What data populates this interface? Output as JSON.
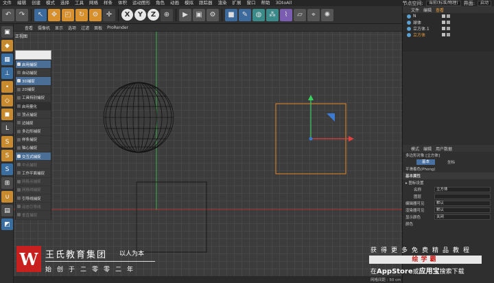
{
  "menu": {
    "items": [
      "文件",
      "编辑",
      "创建",
      "模式",
      "选择",
      "工具",
      "网格",
      "样条",
      "体积",
      "运动图形",
      "角色",
      "动画",
      "模拟",
      "跟踪器",
      "渲染",
      "扩展",
      "窗口",
      "帮助",
      "3DtoAll"
    ],
    "node_space_label": "节点空间:",
    "node_space_value": "当前(标准/物理)",
    "layout_label": "界面:",
    "layout_value": "启动"
  },
  "toolbar": {
    "axis_x": "X",
    "axis_y": "Y",
    "axis_z": "Z"
  },
  "viewport": {
    "menu": [
      "查看",
      "摄像机",
      "显示",
      "选项",
      "过滤",
      "面板",
      "ProRender"
    ],
    "title": "正视图",
    "status": "网格间距 : 50 cm"
  },
  "snap_menu": {
    "items": [
      {
        "label": "启用捕捉",
        "state": "hl"
      },
      {
        "label": "自动捕捉",
        "state": ""
      },
      {
        "label": "3D捕捉",
        "state": "hl"
      },
      {
        "label": "2D捕捉",
        "state": ""
      },
      {
        "label": "工具特别捕捉",
        "state": ""
      },
      {
        "label": "启用量化",
        "state": "head"
      },
      {
        "label": "顶点捕捉",
        "state": ""
      },
      {
        "label": "边捕捉",
        "state": ""
      },
      {
        "label": "多边形捕捉",
        "state": ""
      },
      {
        "label": "样条捕捉",
        "state": ""
      },
      {
        "label": "轴心捕捉",
        "state": ""
      },
      {
        "label": "交互式捕捉",
        "state": "hl"
      },
      {
        "label": "中点捕捉",
        "state": "dim"
      },
      {
        "label": "工作平面捕捉",
        "state": ""
      },
      {
        "label": "网格点捕捉",
        "state": "dim"
      },
      {
        "label": "网格线捕捉",
        "state": "dim"
      },
      {
        "label": "引导线捕捉",
        "state": ""
      },
      {
        "label": "动态引导线",
        "state": "dim"
      },
      {
        "label": "垂直捕捉",
        "state": "dim"
      }
    ]
  },
  "objects": {
    "tabs": [
      "文件",
      "编辑",
      "查看"
    ],
    "items": [
      {
        "name": "N",
        "selected": false
      },
      {
        "name": "球体",
        "selected": false
      },
      {
        "name": "立方体.1",
        "selected": false
      },
      {
        "name": "立方体",
        "selected": true
      }
    ]
  },
  "attributes": {
    "tabs": [
      "模式",
      "编辑",
      "用户数据"
    ],
    "object_label": "多边形对象 [立方体]",
    "tab_basic": "基本",
    "tab_coord": "坐标",
    "phong": "平滑着色(Phong)",
    "section": "基本属性",
    "icon_settings": "▸ 图标设置",
    "name_label": "名称",
    "name_value": "立方体",
    "layer_label": "图层",
    "editor_vis_label": "编辑器可见",
    "editor_vis_value": "默认",
    "render_vis_label": "渲染器可见",
    "render_vis_value": "默认",
    "color_label": "显示颜色",
    "color_value": "关闭",
    "color2_label": "颜色",
    "colors": {
      "accent": "#f0a040",
      "selection": "#4870a0"
    }
  },
  "watermark": {
    "logo": "W",
    "company": "王氏教育集团",
    "slogan": "以人为本",
    "tagline": "始创于二零零二年",
    "promo_line1": "获得更多免费精品教程",
    "promo_line2": "绘学霸",
    "promo_line3_pre": "在",
    "promo_line3_store": "AppStore",
    "promo_line3_mid": "或",
    "promo_line3_app": "应用宝",
    "promo_line3_post": "搜索下载"
  }
}
